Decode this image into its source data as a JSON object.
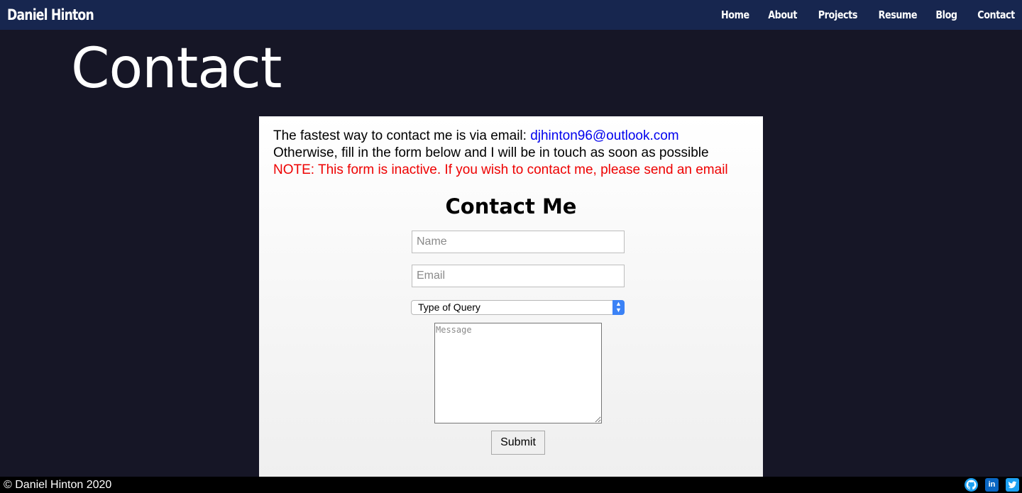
{
  "navbar": {
    "brand": "Daniel Hinton",
    "links": [
      "Home",
      "About",
      "Projects",
      "Resume",
      "Blog",
      "Contact"
    ]
  },
  "page": {
    "title": "Contact"
  },
  "intro": {
    "line1_prefix": "The fastest way to contact me is via email: ",
    "email": "djhinton96@outlook.com",
    "line2": "Otherwise, fill in the form below and I will be in touch as soon as possible",
    "note": "NOTE: This form is inactive. If you wish to contact me, please send an email"
  },
  "form": {
    "title": "Contact Me",
    "name_placeholder": "Name",
    "email_placeholder": "Email",
    "query_selected": "Type of Query",
    "message_placeholder": "Message",
    "submit_label": "Submit"
  },
  "footer": {
    "copyright": "© Daniel Hinton 2020",
    "social": [
      "github-icon",
      "linkedin-icon",
      "twitter-icon"
    ]
  },
  "colors": {
    "navbar_bg": "#17264f",
    "page_bg": "#161626",
    "link": "#0000ee",
    "note": "#ee0000",
    "linkedin": "#0a66c2",
    "twitter": "#1da1f2"
  }
}
